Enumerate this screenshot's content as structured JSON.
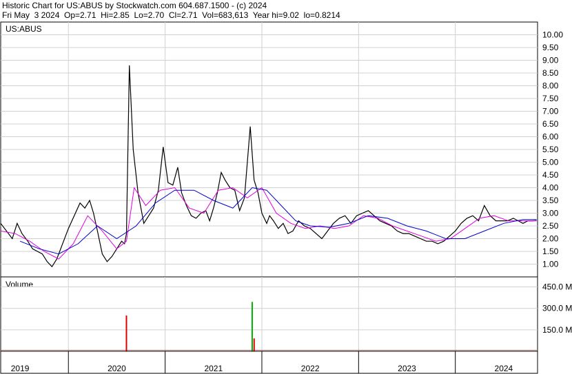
{
  "header": {
    "line1": "Historic Chart for US:ABUS by Stockwatch.com 604.687.1500 - (c) 2024",
    "line2": "Fri May  3 2024  Op=2.71  Hi=2.85  Lo=2.70  Cl=2.71  Vol=683,613  Year hi=9.02  lo=0.8214"
  },
  "chart_data": {
    "type": "line",
    "symbol": "US:ABUS",
    "price_panel": {
      "ylim": [
        0.5,
        10.5
      ],
      "y_ticks": [
        1.0,
        1.5,
        2.0,
        2.5,
        3.0,
        3.5,
        4.0,
        4.5,
        5.0,
        5.5,
        6.0,
        6.5,
        7.0,
        7.5,
        8.0,
        8.5,
        9.0,
        9.5,
        10.0
      ],
      "y_tick_labels": [
        "1.00",
        "1.50",
        "2.00",
        "2.50",
        "3.00",
        "3.50",
        "4.00",
        "4.50",
        "5.00",
        "5.50",
        "6.00",
        "6.50",
        "7.00",
        "7.50",
        "8.00",
        "8.50",
        "9.00",
        "9.50",
        "10.00"
      ],
      "xlim": [
        2018.8,
        2024.35
      ],
      "grid": true,
      "series": [
        {
          "color": "#000000",
          "x": [
            2018.8,
            2018.86,
            2018.92,
            2018.97,
            2019.02,
            2019.08,
            2019.13,
            2019.18,
            2019.23,
            2019.28,
            2019.33,
            2019.38,
            2019.44,
            2019.5,
            2019.56,
            2019.62,
            2019.67,
            2019.72,
            2019.76,
            2019.8,
            2019.85,
            2019.9,
            2019.95,
            2020.0,
            2020.05,
            2020.08,
            2020.1,
            2020.13,
            2020.17,
            2020.22,
            2020.28,
            2020.33,
            2020.38,
            2020.43,
            2020.48,
            2020.53,
            2020.58,
            2020.63,
            2020.67,
            2020.72,
            2020.77,
            2020.82,
            2020.87,
            2020.92,
            2020.96,
            2021.0,
            2021.04,
            2021.08,
            2021.12,
            2021.17,
            2021.22,
            2021.27,
            2021.32,
            2021.38,
            2021.42,
            2021.46,
            2021.5,
            2021.55,
            2021.58,
            2021.62,
            2021.67,
            2021.72,
            2021.77,
            2021.82,
            2021.88,
            2021.94,
            2022.0,
            2022.06,
            2022.12,
            2022.18,
            2022.24,
            2022.3,
            2022.36,
            2022.42,
            2022.48,
            2022.54,
            2022.6,
            2022.66,
            2022.72,
            2022.78,
            2022.84,
            2022.9,
            2022.96,
            2023.02,
            2023.08,
            2023.14,
            2023.2,
            2023.26,
            2023.32,
            2023.38,
            2023.44,
            2023.5,
            2023.56,
            2023.62,
            2023.68,
            2023.74,
            2023.8,
            2023.86,
            2023.92,
            2023.98,
            2024.04,
            2024.1,
            2024.15,
            2024.2,
            2024.25,
            2024.3,
            2024.34
          ],
          "y": [
            2.6,
            2.3,
            2.0,
            2.6,
            2.2,
            1.9,
            1.6,
            1.5,
            1.4,
            1.1,
            0.9,
            1.2,
            1.8,
            2.4,
            2.9,
            3.4,
            3.2,
            3.5,
            3.0,
            2.3,
            1.4,
            1.1,
            1.3,
            1.6,
            1.9,
            1.8,
            2.2,
            8.8,
            5.5,
            3.8,
            2.6,
            2.9,
            3.2,
            3.9,
            5.6,
            4.2,
            4.1,
            4.8,
            3.8,
            3.3,
            2.9,
            2.8,
            3.0,
            3.1,
            2.7,
            3.2,
            3.8,
            4.6,
            4.3,
            4.0,
            3.9,
            3.1,
            3.6,
            6.4,
            4.3,
            3.8,
            3.0,
            2.6,
            2.9,
            2.7,
            2.4,
            2.6,
            2.2,
            2.3,
            2.7,
            2.5,
            2.4,
            2.2,
            2.0,
            2.3,
            2.6,
            2.8,
            2.9,
            2.6,
            2.9,
            3.0,
            3.1,
            2.9,
            2.7,
            2.6,
            2.5,
            2.3,
            2.2,
            2.2,
            2.1,
            2.0,
            1.9,
            1.9,
            1.8,
            1.9,
            2.1,
            2.3,
            2.6,
            2.8,
            2.9,
            2.7,
            3.3,
            2.9,
            2.7,
            2.7,
            2.7,
            2.8,
            2.7,
            2.6,
            2.7,
            2.7,
            2.71
          ]
        },
        {
          "color": "#e000e0",
          "x": [
            2018.8,
            2018.95,
            2019.1,
            2019.25,
            2019.4,
            2019.55,
            2019.7,
            2019.85,
            2020.0,
            2020.1,
            2020.18,
            2020.3,
            2020.45,
            2020.6,
            2020.75,
            2020.9,
            2021.05,
            2021.2,
            2021.35,
            2021.5,
            2021.65,
            2021.8,
            2021.95,
            2022.1,
            2022.25,
            2022.4,
            2022.55,
            2022.7,
            2022.85,
            2023.0,
            2023.15,
            2023.3,
            2023.45,
            2023.6,
            2023.75,
            2023.9,
            2024.05,
            2024.2,
            2024.34
          ],
          "y": [
            2.3,
            2.2,
            1.9,
            1.5,
            1.2,
            1.8,
            2.9,
            2.3,
            1.6,
            1.9,
            4.0,
            3.3,
            3.9,
            4.0,
            3.2,
            3.0,
            3.9,
            4.0,
            3.6,
            4.0,
            3.0,
            2.6,
            2.4,
            2.5,
            2.4,
            2.5,
            2.9,
            2.8,
            2.5,
            2.3,
            2.1,
            1.9,
            2.0,
            2.4,
            2.8,
            2.9,
            2.7,
            2.7,
            2.7
          ]
        },
        {
          "color": "#0000cc",
          "x": [
            2019.0,
            2019.2,
            2019.4,
            2019.6,
            2019.8,
            2020.0,
            2020.2,
            2020.4,
            2020.6,
            2020.8,
            2021.0,
            2021.2,
            2021.4,
            2021.55,
            2021.7,
            2021.85,
            2022.0,
            2022.2,
            2022.4,
            2022.6,
            2022.8,
            2023.0,
            2023.2,
            2023.4,
            2023.6,
            2023.8,
            2024.0,
            2024.2,
            2024.34
          ],
          "y": [
            1.9,
            1.6,
            1.4,
            1.8,
            2.5,
            2.0,
            2.5,
            3.4,
            3.9,
            3.9,
            3.5,
            3.2,
            4.0,
            3.9,
            3.3,
            2.7,
            2.5,
            2.45,
            2.6,
            2.9,
            2.8,
            2.5,
            2.3,
            2.0,
            2.0,
            2.3,
            2.6,
            2.75,
            2.75
          ]
        }
      ]
    },
    "volume_panel": {
      "label": "Volume",
      "ylim": [
        0,
        520
      ],
      "y_ticks": [
        150,
        300,
        450
      ],
      "y_tick_labels": [
        "150.0 M",
        "300.0 M",
        "450.0 M"
      ],
      "bars": [
        {
          "x": 2020.1,
          "value": 250,
          "color": "#e00000"
        },
        {
          "x": 2021.4,
          "value": 345,
          "color": "#00b000"
        },
        {
          "x": 2021.42,
          "value": 90,
          "color": "#e00000"
        }
      ],
      "baseline_value": 10
    },
    "x_axis": {
      "labels": [
        "2019",
        "2020",
        "2021",
        "2022",
        "2023",
        "2024"
      ],
      "label_positions": [
        2019.0,
        2020.0,
        2021.0,
        2022.0,
        2023.0,
        2024.0
      ],
      "year_boundaries": [
        2019.5,
        2020.5,
        2021.5,
        2022.5,
        2023.5
      ]
    }
  }
}
